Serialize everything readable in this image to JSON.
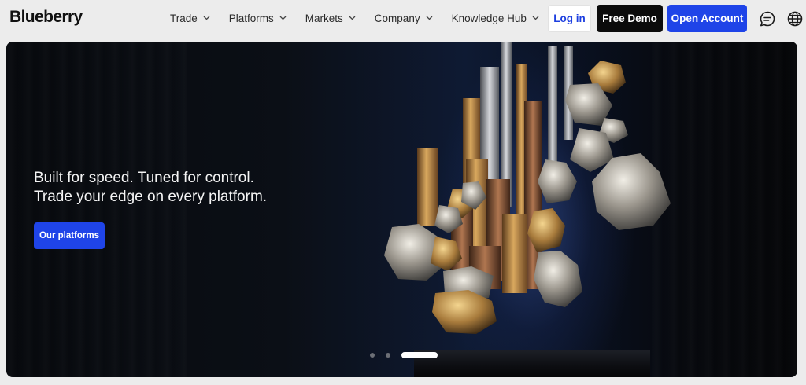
{
  "brand": {
    "name": "Blueberry"
  },
  "nav": {
    "items": [
      {
        "label": "Trade"
      },
      {
        "label": "Platforms"
      },
      {
        "label": "Markets"
      },
      {
        "label": "Company"
      },
      {
        "label": "Knowledge Hub"
      }
    ]
  },
  "actions": {
    "login": "Log in",
    "demo": "Free Demo",
    "open_account": "Open Account"
  },
  "icons": {
    "chat": "chat-icon",
    "globe": "globe-icon",
    "chevron": "chevron-down-icon"
  },
  "hero": {
    "line1": "Built for speed. Tuned for control.",
    "line2": "Trade your edge on every platform.",
    "cta": "Our platforms",
    "carousel": {
      "slides": 3,
      "active": 3
    }
  },
  "colors": {
    "accent": "#1f44e8",
    "dark": "#0b0b0b",
    "hero_bg": "#0b0f16"
  }
}
